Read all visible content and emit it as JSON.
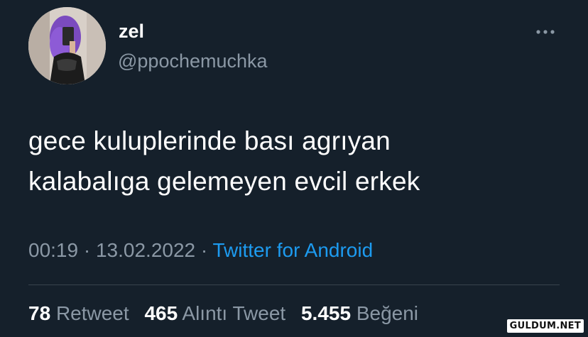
{
  "author": {
    "display_name": "zel",
    "handle": "@ppochemuchka",
    "avatar_icon": "profile-photo"
  },
  "more_icon": "more-horizontal-icon",
  "tweet": {
    "text_line1": "gece kuluplerinde bası agrıyan",
    "text_line2": "kalabalıga gelemeyen evcil erkek"
  },
  "meta": {
    "time": "00:19",
    "separator": "·",
    "date": "13.02.2022",
    "source": "Twitter for Android"
  },
  "stats": {
    "retweets_count": "78",
    "retweets_label": "Retweet",
    "quotes_count": "465",
    "quotes_label": "Alıntı Tweet",
    "likes_count": "5.455",
    "likes_label": "Beğeni"
  },
  "watermark": "GULDUM.NET",
  "colors": {
    "background": "#15202b",
    "secondary_text": "#8b98a5",
    "link": "#1d9bf0",
    "divider": "#38444d"
  }
}
